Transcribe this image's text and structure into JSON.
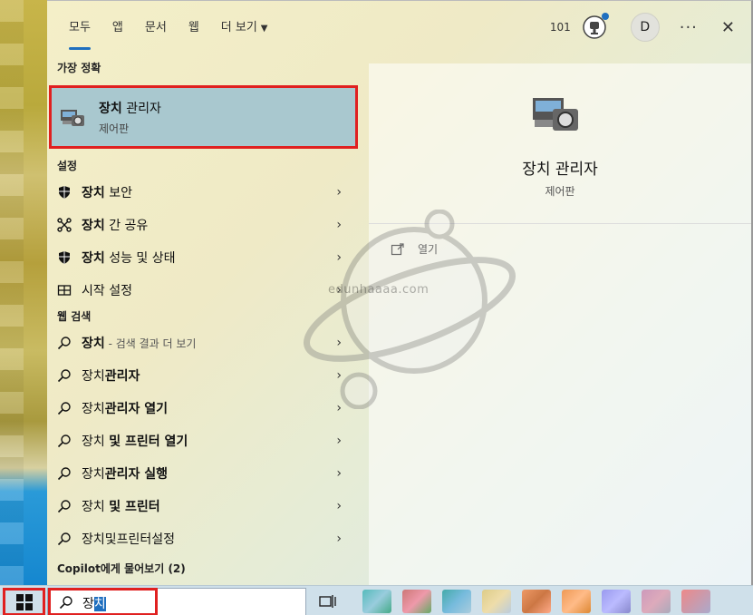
{
  "tabs": [
    {
      "label": "모두",
      "active": true
    },
    {
      "label": "앱",
      "active": false
    },
    {
      "label": "문서",
      "active": false
    },
    {
      "label": "웹",
      "active": false
    },
    {
      "label": "더 보기",
      "active": false
    }
  ],
  "top_right": {
    "points": "101",
    "avatar_letter": "D",
    "more_glyph": "···",
    "close_glyph": "✕"
  },
  "best_match": {
    "header": "가장 정확",
    "title_bold": "장치",
    "title_rest": " 관리자",
    "subtitle": "제어판"
  },
  "settings": {
    "header": "설정",
    "items": [
      {
        "bold": "장치",
        "rest": " 보안",
        "icon": "shield-icon"
      },
      {
        "bold": "장치",
        "rest": " 간 공유",
        "icon": "share-nodes-icon"
      },
      {
        "bold": "장치",
        "rest": " 성능 및 상태",
        "icon": "shield-icon"
      },
      {
        "bold": "",
        "rest": "시작 설정",
        "icon": "start-settings-icon"
      }
    ]
  },
  "web": {
    "header": "웹 검색",
    "items": [
      {
        "bold": "",
        "rest": "장치",
        "sub": " - 검색 결과 더 보기"
      },
      {
        "bold": "관리자",
        "prefix": "장치",
        "rest": ""
      },
      {
        "bold": "관리자 열기",
        "prefix": "장치",
        "rest": ""
      },
      {
        "bold": "및 프린터 열기",
        "prefix": "장치 ",
        "rest": ""
      },
      {
        "bold": "관리자 실행",
        "prefix": "장치",
        "rest": ""
      },
      {
        "bold": "및 프린터",
        "prefix": "장치 ",
        "rest": ""
      },
      {
        "bold": "",
        "prefix": "장치",
        "rest": "및프린터설정"
      }
    ]
  },
  "copilot": {
    "header": "Copilot에게 물어보기 (2)"
  },
  "preview": {
    "title": "장치 관리자",
    "subtitle": "제어판",
    "open_label": "열기"
  },
  "watermark": "edunhaaaa.com",
  "search": {
    "typed": "장",
    "selected": "치"
  },
  "colors": {
    "accent": "#1f6fbf",
    "highlight_border": "#e02020",
    "best_bg": "#a9c8cf"
  }
}
